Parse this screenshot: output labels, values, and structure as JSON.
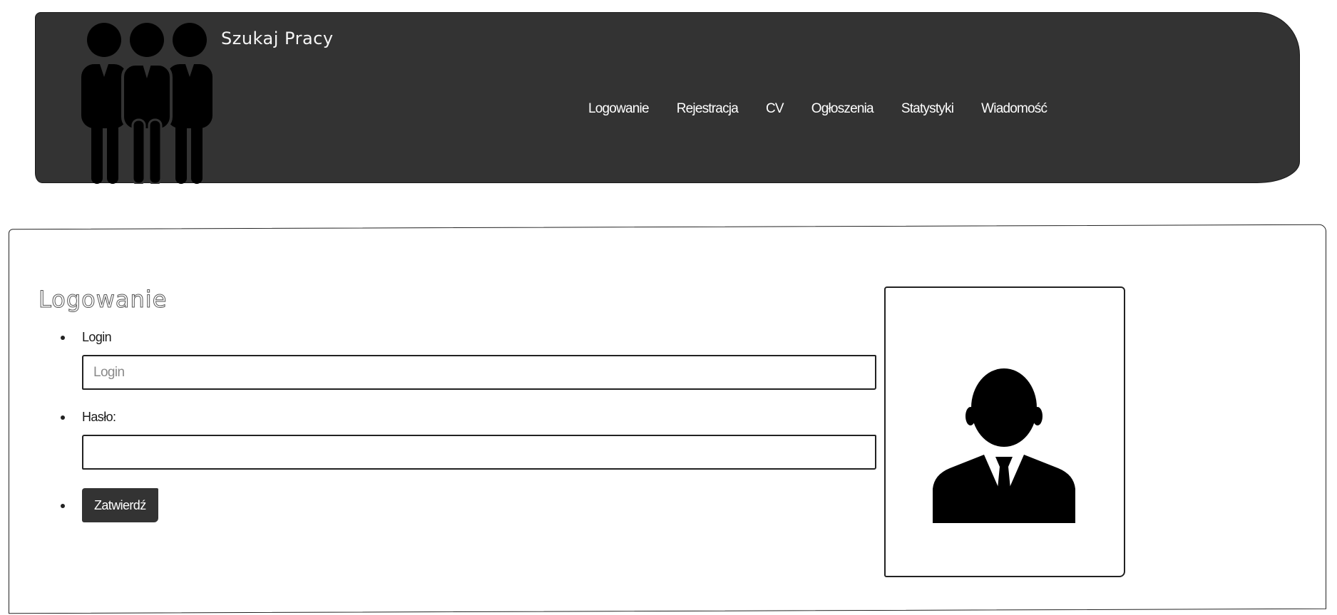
{
  "header": {
    "site_title": "Szukaj Pracy",
    "logo_icon": "people-group-icon",
    "background_color": "#333333"
  },
  "nav": {
    "items": [
      {
        "label": "Logowanie"
      },
      {
        "label": "Rejestracja"
      },
      {
        "label": "CV"
      },
      {
        "label": "Ogłoszenia"
      },
      {
        "label": "Statystyki"
      },
      {
        "label": "Wiadomość"
      }
    ]
  },
  "login_form": {
    "title": "Logowanie",
    "login_label": "Login",
    "login_placeholder": "Login",
    "login_value": "",
    "password_label": "Hasło:",
    "password_value": "",
    "submit_label": "Zatwierdź"
  },
  "avatar": {
    "icon": "user-avatar-icon"
  }
}
